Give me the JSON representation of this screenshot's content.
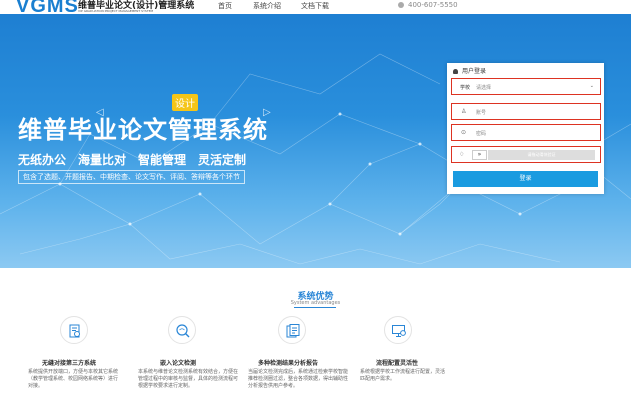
{
  "header": {
    "logo": "VGMS",
    "logo_cn": "维普毕业论文(设计)管理系统",
    "logo_en": "VIP GRADUATION PROJECT MANAGEMENT SYSTEM",
    "nav": [
      "首页",
      "系统介绍",
      "文档下载"
    ],
    "phone": "400-607-5550"
  },
  "banner": {
    "tag": "设计",
    "title": "维普毕业论文管理系统",
    "slogans": [
      "无纸办公",
      "海量比对",
      "智能管理",
      "灵活定制"
    ],
    "features": "包含了选题、开题报告、中期检查、论文写作、评阅、答辩等各个环节"
  },
  "login": {
    "title": "用户登录",
    "school_label": "学校",
    "school_placeholder": "请选择",
    "account_placeholder": "账号",
    "password_placeholder": "密码",
    "slider_text": "请拖动滑块验证",
    "submit": "登录",
    "icons": {
      "user": "user-icon",
      "dropdown": "chevron-down-icon",
      "account": "person-icon",
      "password": "lock-icon",
      "verify": "shield-icon",
      "slider": "double-chevron-right-icon"
    }
  },
  "advantages": {
    "title": "系统优势",
    "subtitle": "System advantages",
    "cards": [
      {
        "icon": "document-settings-icon",
        "title": "无缝对接第三方系统",
        "desc": "系统提供开放端口，方便与本校其它系统（教学管理系统、校园网络系统等）进行对接。"
      },
      {
        "icon": "search-icon",
        "title": "嵌入论文检测",
        "desc": "本系统与维普论文检测系统有效结合，方便在管理过程中的审核与监督，具体的检测流程可根据学校要求进行定制。"
      },
      {
        "icon": "report-icon",
        "title": "多种检测结果分析报告",
        "desc": "当届论文检测完成后，系统通过检索学校智能推荐检测圈过滤，整合各项数据，得出辅助性分析报告供用户参考。"
      },
      {
        "icon": "monitor-settings-icon",
        "title": "流程配置灵活性",
        "desc": "系统根据学校工作流程进行配置，灵活匹配用户需求。"
      }
    ]
  },
  "colors": {
    "brand": "#1a7fd0",
    "button": "#1a9be0",
    "tag": "#f5c518",
    "highlight": "#dd3322"
  }
}
